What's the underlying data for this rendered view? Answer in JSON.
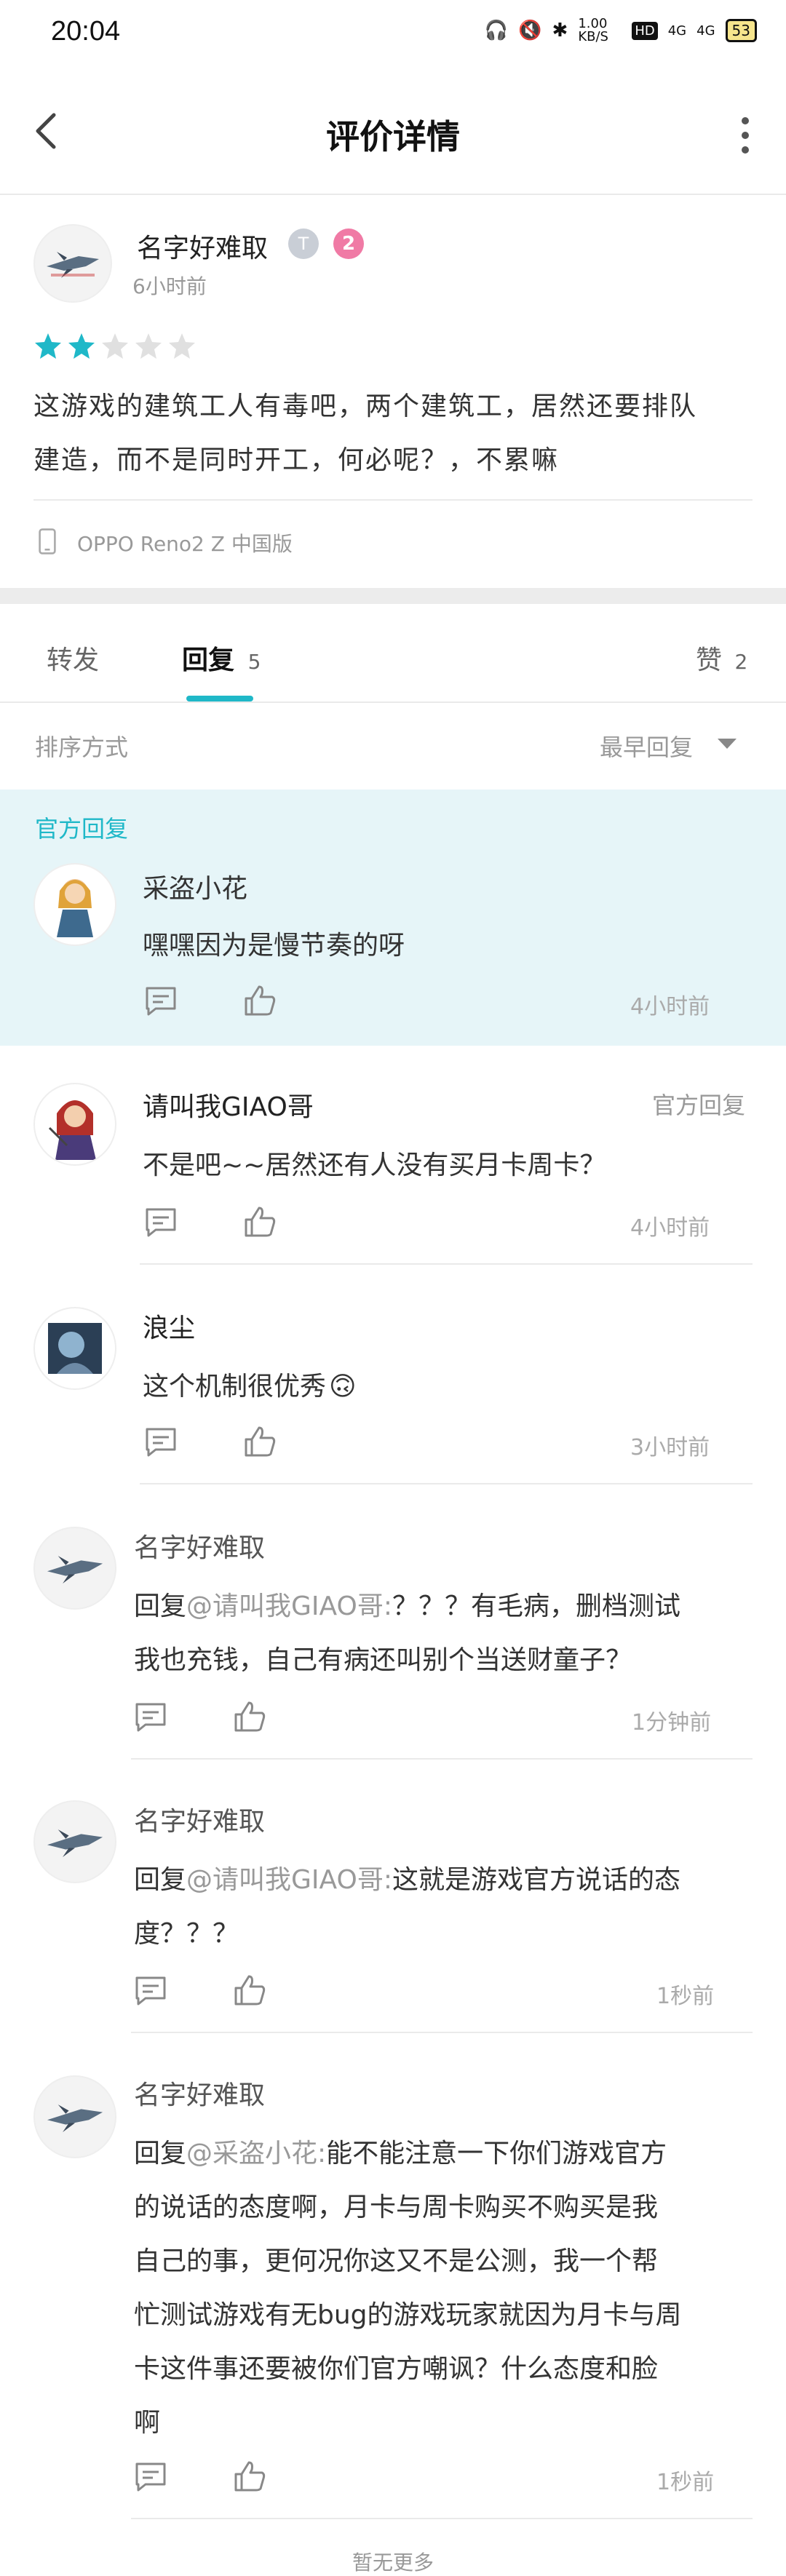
{
  "status_bar": {
    "time": "20:04",
    "net_speed": "1.00 KB/S",
    "hd": "HD",
    "sig1": "4G",
    "sig2": "4G",
    "battery": "53"
  },
  "header": {
    "title": "评价详情"
  },
  "review": {
    "author": "名字好难取",
    "time": "6小时前",
    "rating": 2,
    "rating_max": 5,
    "badge2": "2",
    "text_line1": "这游戏的建筑工人有毒吧，两个建筑工，居然还要排队",
    "text_line2": "建造，而不是同时开工，何必呢？，不累嘛",
    "device": "OPPO Reno2 Z 中国版"
  },
  "tabs": {
    "forward": "转发",
    "reply": "回复",
    "reply_count": "5",
    "like": "赞",
    "like_count": "2"
  },
  "sort": {
    "label": "排序方式",
    "value": "最早回复"
  },
  "official": {
    "label": "官方回复",
    "name": "采盗小花",
    "text": "嘿嘿因为是慢节奏的呀",
    "time": "4小时前"
  },
  "replies": [
    {
      "name": "请叫我GIAO哥",
      "tag": "官方回复",
      "text": "不是吧~~居然还有人没有买月卡周卡？",
      "time": "4小时前"
    },
    {
      "name": "浪尘",
      "text": "这个机制很优秀",
      "emoji": "🙃",
      "time": "3小时前"
    },
    {
      "name": "名字好难取",
      "prefix": "回复",
      "mention": "@请叫我GIAO哥:",
      "line1": "？？？有毛病，删档测试",
      "line2": "我也充钱，自己有病还叫别个当送财童子？",
      "time": "1分钟前"
    },
    {
      "name": "名字好难取",
      "prefix": "回复",
      "mention": "@请叫我GIAO哥:",
      "line1": "这就是游戏官方说话的态",
      "line2": "度？？？",
      "time": "1秒前"
    },
    {
      "name": "名字好难取",
      "prefix": "回复",
      "mention": "@采盗小花:",
      "line1": "能不能注意一下你们游戏官方",
      "line2": "的说话的态度啊，月卡与周卡购买不购买是我",
      "line3": "自己的事，更何况你这又不是公测，我一个帮",
      "line4": "忙测试游戏有无bug的游戏玩家就因为月卡与周",
      "line5": "卡这件事还要被你们官方嘲讽？什么态度和脸",
      "line6": "啊",
      "time": "1秒前"
    }
  ],
  "footer": {
    "text": "暂无更多"
  },
  "colors": {
    "accent": "#1fb8c8",
    "star_on": "#1fb8c8",
    "star_off": "#e0e0e0",
    "official_bg": "#e6f5f8"
  }
}
